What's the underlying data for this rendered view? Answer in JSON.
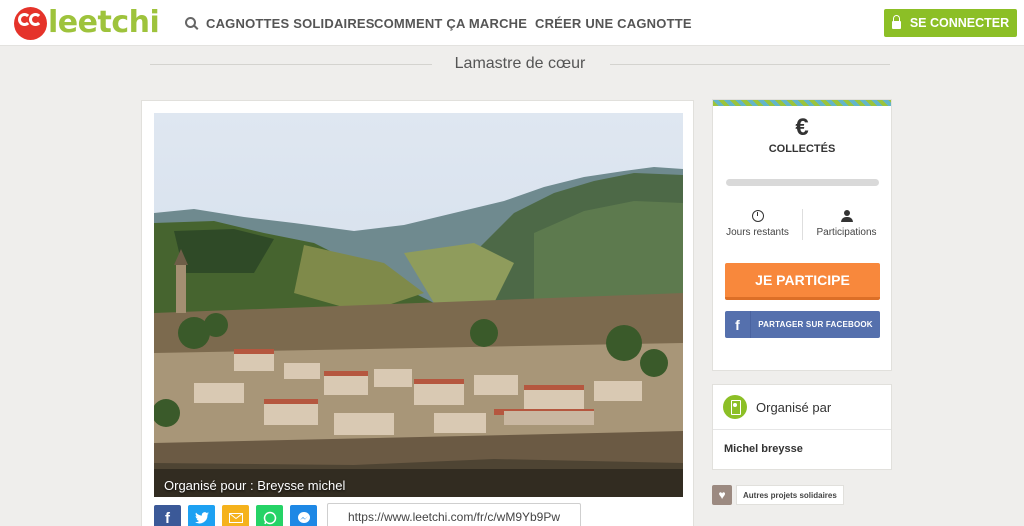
{
  "header": {
    "logo_text": "leetchi",
    "nav": {
      "search": "CAGNOTTES SOLIDAIRES",
      "how": "COMMENT ÇA MARCHE",
      "create": "CRÉER UNE CAGNOTTE"
    },
    "login_label": "SE CONNECTER"
  },
  "page": {
    "title": "Lamastre de cœur"
  },
  "main": {
    "photo_caption": "Organisé pour : Breysse michel",
    "share_buttons": [
      "facebook-icon",
      "twitter-icon",
      "mail-icon",
      "whatsapp-icon",
      "messenger-icon"
    ],
    "share_url": "https://www.leetchi.com/fr/c/wM9Yb9Pw"
  },
  "sidebar": {
    "currency_symbol": "€",
    "collected_label": "COLLECTÉS",
    "progress_fraction": 0,
    "days_label": "Jours restants",
    "participations_label": "Participations",
    "participate_label": "JE PARTICIPE",
    "facebook_share_label": "PARTAGER SUR FACEBOOK"
  },
  "organiser": {
    "title": "Organisé par",
    "name": "Michel breysse"
  },
  "other_projects_label": "Autres projets solidaires",
  "colors": {
    "brand_green": "#8cbf26",
    "brand_red": "#e5332a",
    "participate_orange": "#f8883c",
    "facebook_blue": "#5570ad"
  }
}
